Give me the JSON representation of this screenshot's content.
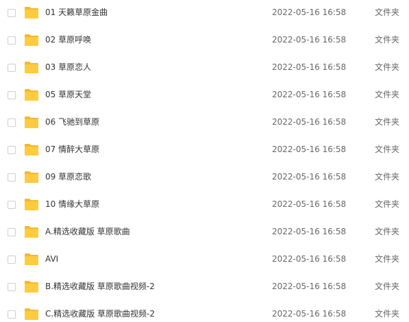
{
  "icon": "folder-icon",
  "folder_color": "#FFCB3F",
  "folder_tab_color": "#F5B82E",
  "files": [
    {
      "name": "01 天籁草原金曲",
      "date": "2022-05-16 16:58",
      "type": "文件夹"
    },
    {
      "name": "02 草原呼唤",
      "date": "2022-05-16 16:58",
      "type": "文件夹"
    },
    {
      "name": "03 草原恋人",
      "date": "2022-05-16 16:58",
      "type": "文件夹"
    },
    {
      "name": "05 草原天堂",
      "date": "2022-05-16 16:58",
      "type": "文件夹"
    },
    {
      "name": "06 飞驰到草原",
      "date": "2022-05-16 16:58",
      "type": "文件夹"
    },
    {
      "name": "07 情醉大草原",
      "date": "2022-05-16 16:58",
      "type": "文件夹"
    },
    {
      "name": "09 草原恋歌",
      "date": "2022-05-16 16:58",
      "type": "文件夹"
    },
    {
      "name": "10 情缘大草原",
      "date": "2022-05-16 16:58",
      "type": "文件夹"
    },
    {
      "name": "A.精选收藏版 草原歌曲",
      "date": "2022-05-16 16:58",
      "type": "文件夹"
    },
    {
      "name": "AVI",
      "date": "2022-05-16 16:58",
      "type": "文件夹"
    },
    {
      "name": "B.精选收藏版 草原歌曲视频-2",
      "date": "2022-05-16 16:58",
      "type": "文件夹"
    },
    {
      "name": "C.精选收藏版 草原歌曲视频-2",
      "date": "2022-05-16 16:58",
      "type": "文件夹"
    }
  ]
}
